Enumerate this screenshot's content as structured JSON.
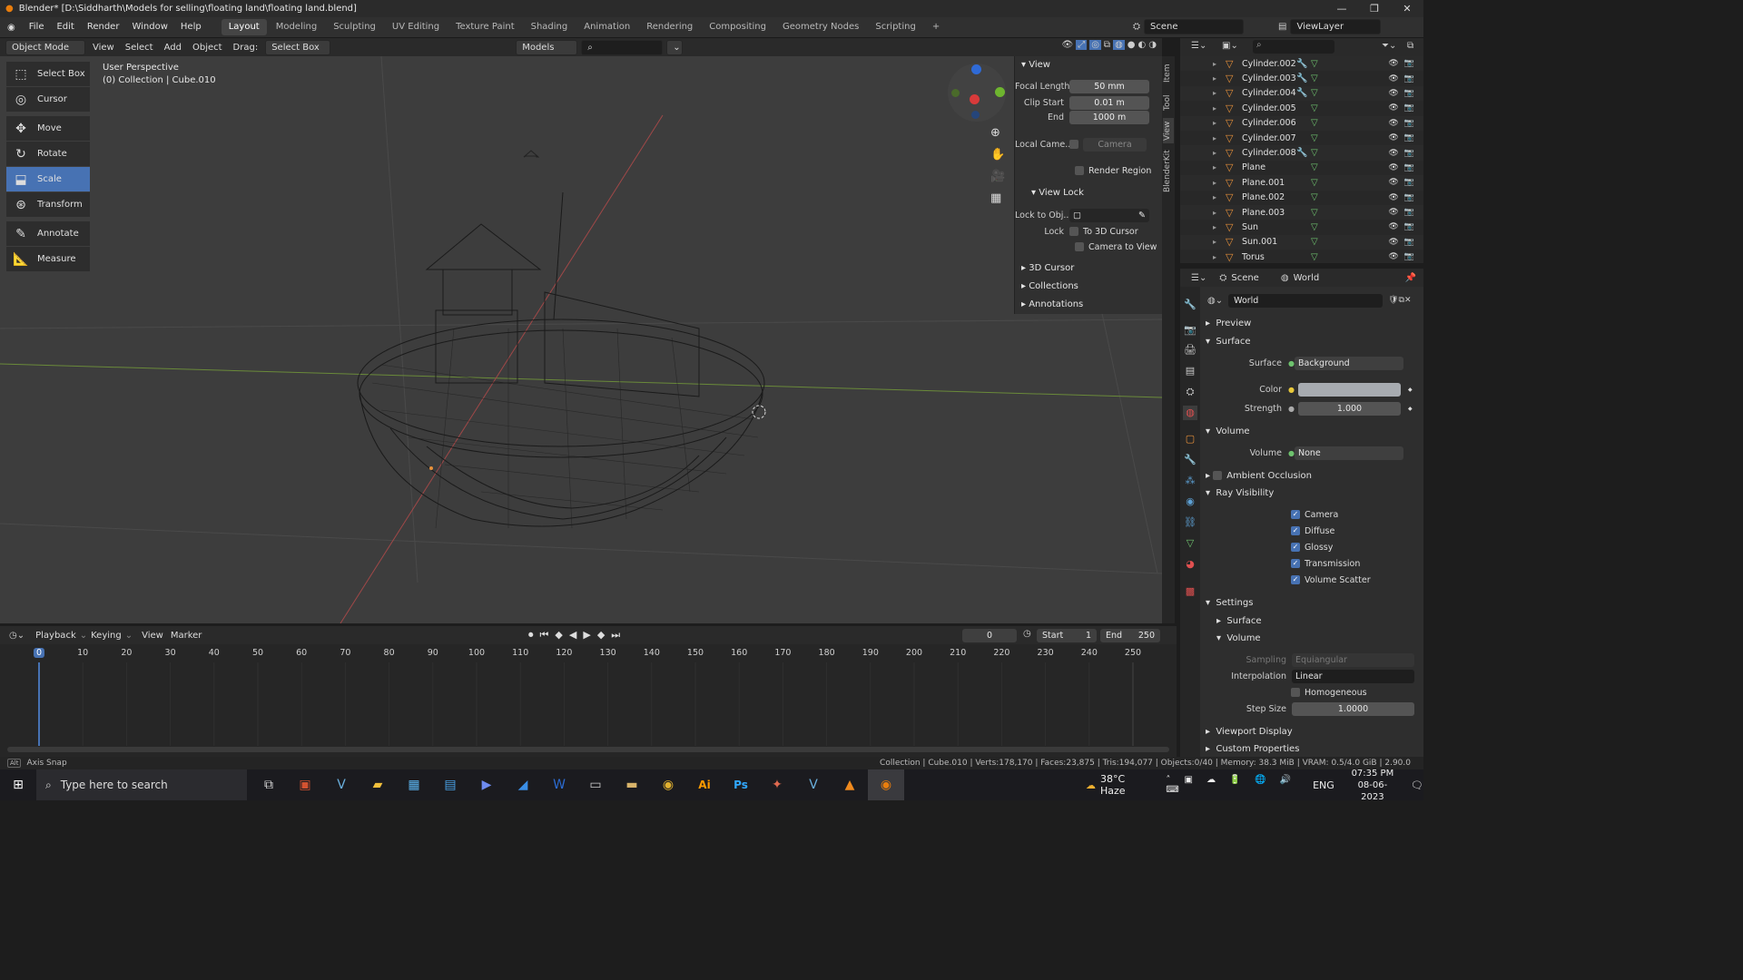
{
  "window": {
    "title": "Blender* [D:\\Siddharth\\Models for selling\\floating land\\floating land.blend]",
    "min": "—",
    "max": "❐",
    "close": "✕"
  },
  "menu": [
    "File",
    "Edit",
    "Render",
    "Window",
    "Help"
  ],
  "workspaces": [
    "Layout",
    "Modeling",
    "Sculpting",
    "UV Editing",
    "Texture Paint",
    "Shading",
    "Animation",
    "Rendering",
    "Compositing",
    "Geometry Nodes",
    "Scripting",
    "+"
  ],
  "top_right": {
    "scene": "Scene",
    "view_layer": "ViewLayer"
  },
  "viewport_header": {
    "mode": "Object Mode",
    "view": "View",
    "select": "Select",
    "add": "Add",
    "object": "Object",
    "drag_label": "Drag:",
    "drag_value": "Select Box",
    "models": "Models"
  },
  "viewport": {
    "perspective": "User Perspective",
    "collection": "(0) Collection | Cube.010"
  },
  "tools": [
    "Select Box",
    "Cursor",
    "Move",
    "Rotate",
    "Scale",
    "Transform",
    "Annotate",
    "Measure"
  ],
  "tool_active": "Scale",
  "npanel": {
    "section": "View",
    "focal_label": "Focal Length",
    "focal": "50 mm",
    "clip_start_label": "Clip Start",
    "clip_start": "0.01 m",
    "end_label": "End",
    "end": "1000 m",
    "local_cam_label": "Local Came...",
    "local_cam": "Camera",
    "render_region": "Render Region",
    "view_lock": "View Lock",
    "lock_obj_label": "Lock to Obj...",
    "lock_label": "Lock",
    "to_cursor": "To 3D Cursor",
    "cam_to_view": "Camera to View",
    "cursor": "3D Cursor",
    "collections": "Collections",
    "annotations": "Annotations",
    "tabs": [
      "Item",
      "Tool",
      "View",
      "BlenderKit"
    ]
  },
  "outliner": [
    {
      "name": "Cylinder.002",
      "mod": true
    },
    {
      "name": "Cylinder.003",
      "mod": true
    },
    {
      "name": "Cylinder.004",
      "mod": true
    },
    {
      "name": "Cylinder.005",
      "mod": false
    },
    {
      "name": "Cylinder.006",
      "mod": false
    },
    {
      "name": "Cylinder.007",
      "mod": false
    },
    {
      "name": "Cylinder.008",
      "mod": true
    },
    {
      "name": "Plane",
      "mod": false
    },
    {
      "name": "Plane.001",
      "mod": false
    },
    {
      "name": "Plane.002",
      "mod": false
    },
    {
      "name": "Plane.003",
      "mod": false
    },
    {
      "name": "Sun",
      "mod": false
    },
    {
      "name": "Sun.001",
      "mod": false
    },
    {
      "name": "Torus",
      "mod": false
    }
  ],
  "properties": {
    "scene_tab": "Scene",
    "world_tab": "World",
    "world_name": "World",
    "preview": "Preview",
    "surface_sec": "Surface",
    "surface_label": "Surface",
    "surface_val": "Background",
    "color_label": "Color",
    "strength_label": "Strength",
    "strength": "1.000",
    "volume_sec": "Volume",
    "volume_label": "Volume",
    "volume_val": "None",
    "ao": "Ambient Occlusion",
    "ray_vis": "Ray Visibility",
    "rays": [
      "Camera",
      "Diffuse",
      "Glossy",
      "Transmission",
      "Volume Scatter"
    ],
    "settings": "Settings",
    "set_surface": "Surface",
    "set_volume": "Volume",
    "sampling_label": "Sampling",
    "sampling": "Equiangular",
    "interp_label": "Interpolation",
    "interp": "Linear",
    "homogeneous": "Homogeneous",
    "step_label": "Step Size",
    "step": "1.0000",
    "viewport_display": "Viewport Display",
    "custom_props": "Custom Properties",
    "world_color": "#a7abb0"
  },
  "timeline": {
    "playback": "Playback",
    "keying": "Keying",
    "view": "View",
    "marker": "Marker",
    "frame": "0",
    "start_label": "Start",
    "start": "1",
    "end_label": "End",
    "end": "250",
    "ticks": [
      "0",
      "10",
      "20",
      "30",
      "40",
      "50",
      "60",
      "70",
      "80",
      "90",
      "100",
      "110",
      "120",
      "130",
      "140",
      "150",
      "160",
      "170",
      "180",
      "190",
      "200",
      "210",
      "220",
      "230",
      "240",
      "250"
    ]
  },
  "status": {
    "left": "Axis Snap",
    "right": "Collection | Cube.010 | Verts:178,170 | Faces:23,875 | Tris:194,077 | Objects:0/40 | Memory: 38.3 MiB | VRAM: 0.5/4.0 GiB | 2.90.0"
  },
  "taskbar": {
    "search": "Type here to search",
    "weather": "38°C  Haze",
    "lang": "ENG",
    "time": "07:35 PM",
    "date": "08-06-2023"
  }
}
